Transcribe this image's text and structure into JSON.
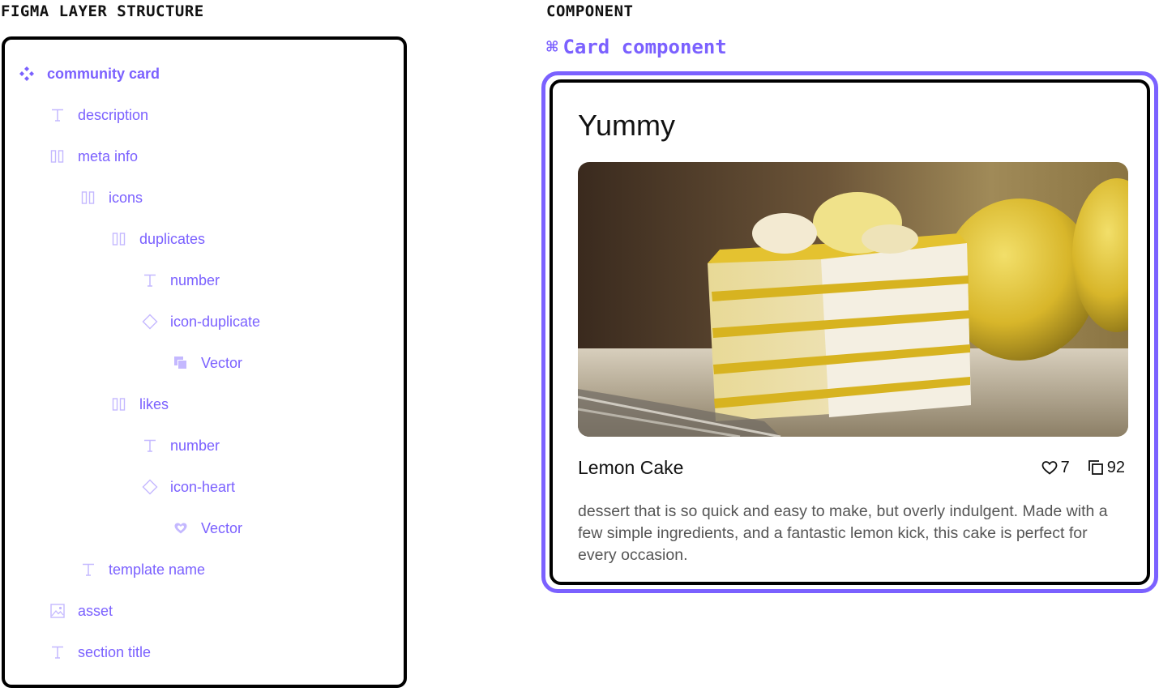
{
  "headings": {
    "layers": "FIGMA LAYER STRUCTURE",
    "component": "COMPONENT"
  },
  "colors": {
    "accent": "#7b61ff",
    "border": "#000000",
    "text": "#111111",
    "muted_text": "#555555"
  },
  "layers": [
    {
      "label": "community card",
      "icon": "component-icon"
    },
    {
      "label": "description",
      "icon": "text-icon"
    },
    {
      "label": "meta info",
      "icon": "auto-layout-icon"
    },
    {
      "label": "icons",
      "icon": "auto-layout-icon"
    },
    {
      "label": "duplicates",
      "icon": "auto-layout-icon"
    },
    {
      "label": "number",
      "icon": "text-icon"
    },
    {
      "label": "icon-duplicate",
      "icon": "instance-icon"
    },
    {
      "label": "Vector",
      "icon": "duplicate-vector-icon"
    },
    {
      "label": "likes",
      "icon": "auto-layout-icon"
    },
    {
      "label": "number",
      "icon": "text-icon"
    },
    {
      "label": "icon-heart",
      "icon": "instance-icon"
    },
    {
      "label": "Vector",
      "icon": "heart-vector-icon"
    },
    {
      "label": "template name",
      "icon": "text-icon"
    },
    {
      "label": "asset",
      "icon": "image-icon"
    },
    {
      "label": "section title",
      "icon": "text-icon"
    }
  ],
  "component": {
    "title": "Card component",
    "title_icon": "command-icon"
  },
  "card": {
    "section_title": "Yummy",
    "asset_icon": "lemon-cake-photo",
    "template_name": "Lemon Cake",
    "likes": "7",
    "duplicates": "92",
    "description": "dessert that is so quick and easy to make, but overly indulgent. Made with a few simple ingredients, and a fantastic lemon kick, this cake is perfect for every occasion."
  }
}
